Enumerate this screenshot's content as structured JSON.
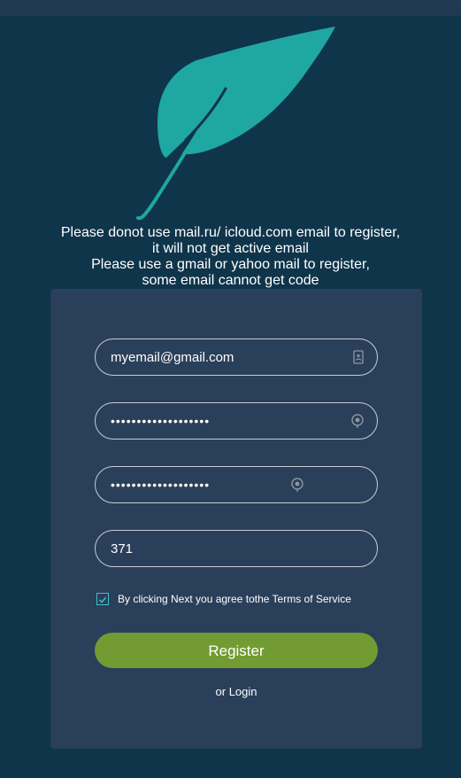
{
  "notice": {
    "lines": [
      "Please donot use mail.ru/ icloud.com email to register,",
      "it will not get active email",
      "Please use a gmail or yahoo mail to register,",
      "some email cannot get code"
    ]
  },
  "form": {
    "email": {
      "value": "myemail@gmail.com",
      "icon": "contact-card-icon"
    },
    "password": {
      "value": "•••••••••••••••••••",
      "icon": "eye-icon"
    },
    "confirm_password": {
      "value": "•••••••••••••••••••",
      "icon": "eye-icon"
    },
    "code": {
      "value": "371"
    },
    "agree": {
      "checked": true,
      "label": "By clicking Next you agree tothe Terms of Service"
    },
    "register_label": "Register",
    "login_prefix": "or",
    "login_label": "Login"
  },
  "colors": {
    "background": "#0f354b",
    "card": "#2a3f5a",
    "logo": "#1fa7a2",
    "accent_button": "#729b31",
    "checkbox": "#3ec2c4"
  }
}
